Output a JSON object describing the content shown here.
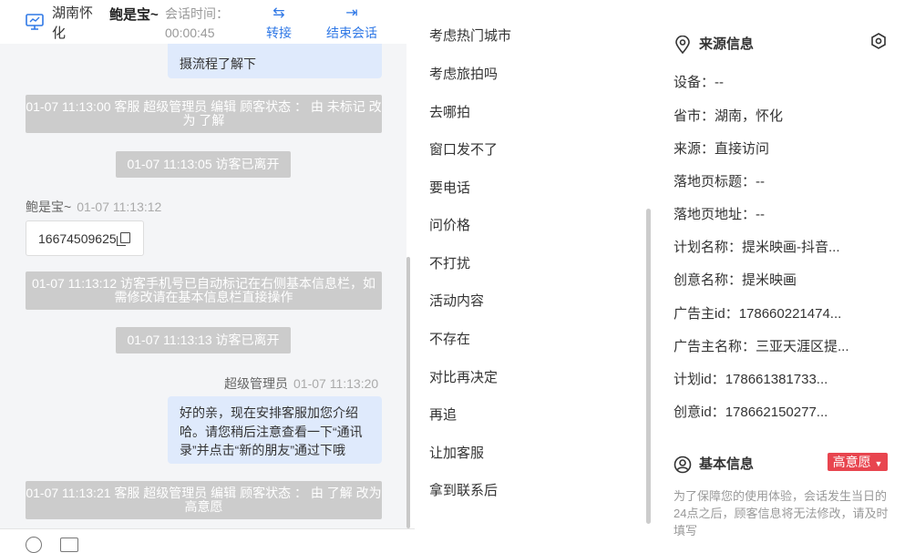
{
  "header": {
    "location": "湖南怀化",
    "visitor_name": "鲍是宝~",
    "session_time_label": "会话时间：",
    "session_time_value": "00:00:45",
    "transfer_label": "转接",
    "end_label": "结束会话"
  },
  "chat": {
    "cut_message": "摄流程了解下",
    "messages": [
      {
        "type": "system",
        "text": "01-07 11:13:00 客服 超级管理员 编辑 顾客状态 ： 由 未标记 改为 了解"
      },
      {
        "type": "system",
        "text": "01-07 11:13:05 访客已离开"
      },
      {
        "type": "meta",
        "name": "鲍是宝~",
        "time": "01-07 11:13:12"
      },
      {
        "type": "phone",
        "text": "16674509625"
      },
      {
        "type": "system",
        "text": "01-07 11:13:12 访客手机号已自动标记在右侧基本信息栏，如需修改请在基本信息栏直接操作"
      },
      {
        "type": "system",
        "text": "01-07 11:13:13 访客已离开"
      },
      {
        "type": "meta",
        "name": "超级管理员",
        "time": "01-07 11:13:20"
      },
      {
        "type": "bubble",
        "text": "好的亲，现在安排客服加您介绍哈。请您稍后注意查看一下“通讯录”并点击“新的朋友”通过下哦"
      },
      {
        "type": "system",
        "text": "01-07 11:13:21 客服 超级管理员 编辑 顾客状态 ： 由 了解 改为 高意愿"
      }
    ]
  },
  "quick_replies": [
    "考虑热门城市",
    "考虑旅拍吗",
    "去哪拍",
    "窗口发不了",
    "要电话",
    "问价格",
    "不打扰",
    "活动内容",
    "不存在",
    "对比再决定",
    "再追",
    "让加客服",
    "拿到联系后"
  ],
  "source_info": {
    "title": "来源信息",
    "rows": [
      {
        "label": "设备：",
        "value": "--"
      },
      {
        "label": "省市：",
        "value": "湖南，怀化"
      },
      {
        "label": "来源：",
        "value": "直接访问"
      },
      {
        "label": "落地页标题：",
        "value": "--"
      },
      {
        "label": "落地页地址：",
        "value": "--"
      },
      {
        "label": "计划名称：",
        "value": "提米映画-抖音..."
      },
      {
        "label": "创意名称：",
        "value": "提米映画"
      },
      {
        "label": "广告主id：",
        "value": "178660221474..."
      },
      {
        "label": "广告主名称：",
        "value": "三亚天涯区提..."
      },
      {
        "label": "计划id：",
        "value": "178661381733..."
      },
      {
        "label": "创意id：",
        "value": "178662150277..."
      }
    ]
  },
  "basic_info": {
    "title": "基本信息",
    "status_badge": "高意愿",
    "hint": "为了保障您的使用体验，会话发生当日的24点之后，顾客信息将无法修改，请及时填写"
  },
  "colors": {
    "accent": "#2f78e6",
    "badge": "#e8454f",
    "system_msg_bg": "#cccccc",
    "self_bubble": "#dfeafc"
  }
}
